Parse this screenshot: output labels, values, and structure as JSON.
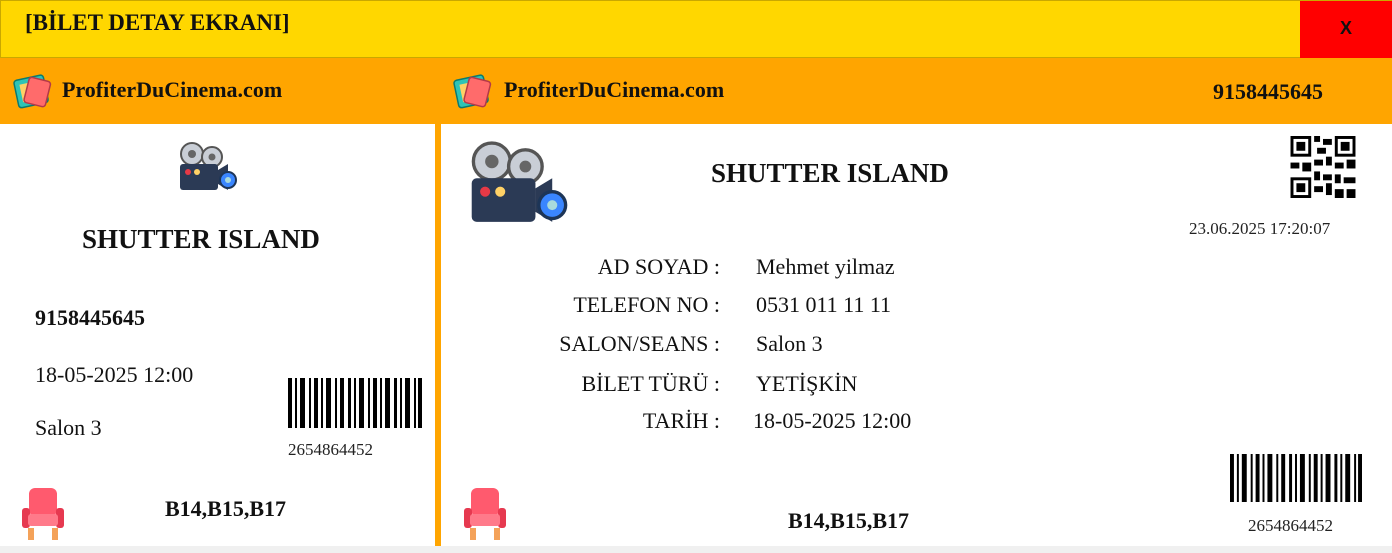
{
  "window": {
    "title": "[BİLET DETAY EKRANI]",
    "close_label": "X"
  },
  "brand": {
    "name": "ProfiterDuCinema.com"
  },
  "ticket_number": "9158445645",
  "movie_title": "SHUTTER ISLAND",
  "stub": {
    "ticket_number": "9158445645",
    "datetime": "18-05-2025 12:00",
    "salon": "Salon 3",
    "barcode_number": "2654864452",
    "seats": "B14,B15,B17"
  },
  "main": {
    "printed_at": "23.06.2025 17:20:07",
    "fields": [
      {
        "label": "AD SOYAD :",
        "value": "Mehmet yilmaz"
      },
      {
        "label": "TELEFON NO :",
        "value": "0531 011 11 11"
      },
      {
        "label": "SALON/SEANS :",
        "value": "Salon 3"
      },
      {
        "label": "BİLET TÜRÜ :",
        "value": "YETİŞKİN"
      },
      {
        "label": "TARİH :",
        "value": "18-05-2025 12:00"
      }
    ],
    "seats": "B14,B15,B17",
    "barcode_number": "2654864452"
  },
  "icons": {
    "ticket": "ticket-icon",
    "camera": "movie-camera-icon",
    "seat": "cinema-seat-icon",
    "qr": "qr-code-icon",
    "barcode": "barcode-icon"
  },
  "colors": {
    "titlebar": "#ffd700",
    "band": "#ffa500",
    "close": "#ff0000"
  }
}
